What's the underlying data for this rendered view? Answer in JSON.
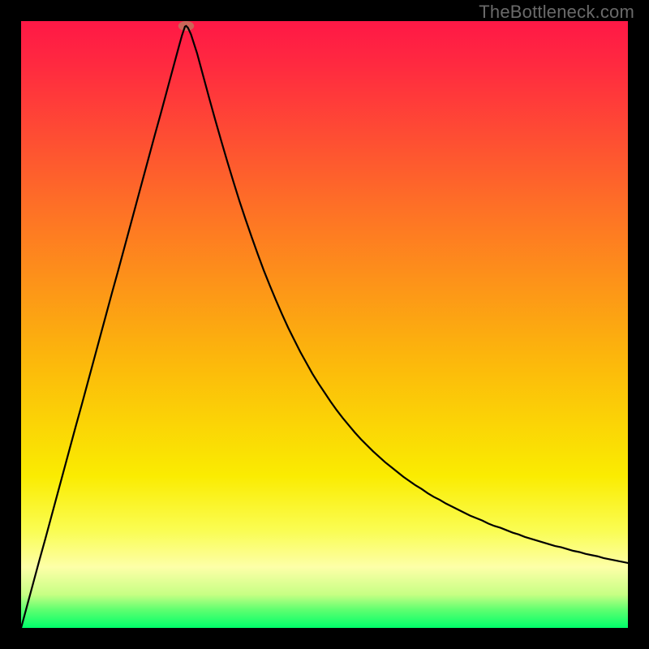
{
  "attribution": "TheBottleneck.com",
  "chart_data": {
    "type": "line",
    "title": "",
    "xlabel": "",
    "ylabel": "",
    "xlim": [
      0,
      1
    ],
    "ylim": [
      0,
      1
    ],
    "background": {
      "gradient_stops": [
        {
          "offset": 0.0,
          "color": "#ff1846"
        },
        {
          "offset": 0.07,
          "color": "#ff2940"
        },
        {
          "offset": 0.3,
          "color": "#fe6e27"
        },
        {
          "offset": 0.55,
          "color": "#fcb50c"
        },
        {
          "offset": 0.75,
          "color": "#faec01"
        },
        {
          "offset": 0.84,
          "color": "#fafd53"
        },
        {
          "offset": 0.9,
          "color": "#fdffa8"
        },
        {
          "offset": 0.945,
          "color": "#c7ff84"
        },
        {
          "offset": 0.97,
          "color": "#5fff70"
        },
        {
          "offset": 1.0,
          "color": "#00ff6a"
        }
      ]
    },
    "marker": {
      "x": 0.272,
      "y": 0.992,
      "color": "#cc6658",
      "rx": 0.013,
      "ry": 0.008
    },
    "series": [
      {
        "name": "curve",
        "stroke": "#000000",
        "stroke_width": 2.2,
        "x": [
          0.0,
          0.01,
          0.02,
          0.03,
          0.04,
          0.05,
          0.06,
          0.07,
          0.08,
          0.09,
          0.1,
          0.11,
          0.12,
          0.13,
          0.14,
          0.15,
          0.16,
          0.17,
          0.18,
          0.19,
          0.2,
          0.21,
          0.22,
          0.23,
          0.24,
          0.25,
          0.26,
          0.265,
          0.27,
          0.272,
          0.275,
          0.28,
          0.29,
          0.3,
          0.31,
          0.32,
          0.33,
          0.34,
          0.35,
          0.36,
          0.37,
          0.38,
          0.39,
          0.4,
          0.41,
          0.42,
          0.43,
          0.44,
          0.45,
          0.46,
          0.47,
          0.48,
          0.49,
          0.5,
          0.51,
          0.52,
          0.53,
          0.54,
          0.55,
          0.56,
          0.57,
          0.58,
          0.59,
          0.6,
          0.61,
          0.62,
          0.63,
          0.64,
          0.65,
          0.66,
          0.67,
          0.68,
          0.69,
          0.7,
          0.71,
          0.72,
          0.73,
          0.74,
          0.75,
          0.76,
          0.77,
          0.78,
          0.79,
          0.8,
          0.81,
          0.82,
          0.83,
          0.84,
          0.85,
          0.86,
          0.87,
          0.88,
          0.89,
          0.9,
          0.91,
          0.92,
          0.93,
          0.94,
          0.95,
          0.96,
          0.97,
          0.98,
          0.99,
          1.0
        ],
        "y": [
          0.0,
          0.037,
          0.074,
          0.111,
          0.147,
          0.184,
          0.221,
          0.258,
          0.295,
          0.332,
          0.368,
          0.405,
          0.442,
          0.479,
          0.516,
          0.553,
          0.589,
          0.626,
          0.663,
          0.7,
          0.737,
          0.774,
          0.811,
          0.847,
          0.884,
          0.921,
          0.958,
          0.976,
          0.991,
          0.992,
          0.989,
          0.978,
          0.947,
          0.91,
          0.873,
          0.837,
          0.802,
          0.768,
          0.735,
          0.703,
          0.673,
          0.644,
          0.616,
          0.589,
          0.564,
          0.54,
          0.517,
          0.495,
          0.475,
          0.455,
          0.437,
          0.419,
          0.403,
          0.388,
          0.373,
          0.359,
          0.346,
          0.334,
          0.322,
          0.311,
          0.301,
          0.291,
          0.282,
          0.273,
          0.265,
          0.257,
          0.249,
          0.242,
          0.235,
          0.229,
          0.222,
          0.216,
          0.211,
          0.205,
          0.2,
          0.195,
          0.19,
          0.185,
          0.181,
          0.177,
          0.172,
          0.168,
          0.165,
          0.161,
          0.157,
          0.154,
          0.15,
          0.147,
          0.144,
          0.141,
          0.138,
          0.135,
          0.133,
          0.13,
          0.127,
          0.125,
          0.122,
          0.12,
          0.118,
          0.115,
          0.113,
          0.111,
          0.109,
          0.107
        ]
      }
    ]
  }
}
